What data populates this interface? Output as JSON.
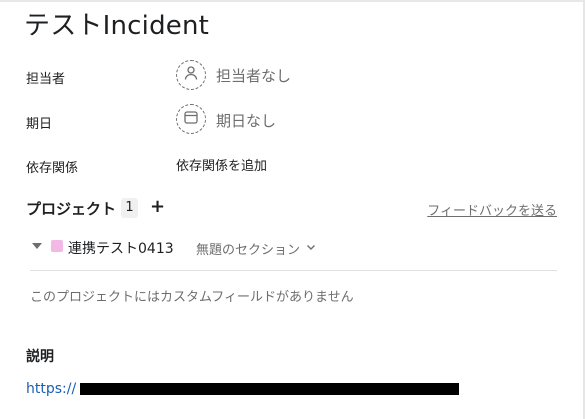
{
  "task": {
    "title": "テストIncident",
    "assignee": {
      "label": "担当者",
      "value": "担当者なし"
    },
    "due_date": {
      "label": "期日",
      "value": "期日なし"
    },
    "dependencies": {
      "label": "依存関係",
      "action": "依存関係を追加"
    }
  },
  "projects": {
    "heading": "プロジェクト",
    "count": "1",
    "add": "+",
    "feedback": "フィードバックを送る",
    "items": [
      {
        "name": "連携テスト0413",
        "color": "#f1b9e3",
        "section": "無題のセクション"
      }
    ],
    "no_custom_fields": "このプロジェクトにはカスタムフィールドがありません"
  },
  "description": {
    "heading": "説明",
    "link_prefix": "https://"
  },
  "icons": [
    "person-icon",
    "calendar-icon",
    "caret-down-icon",
    "chevron-down-icon",
    "plus-icon"
  ]
}
